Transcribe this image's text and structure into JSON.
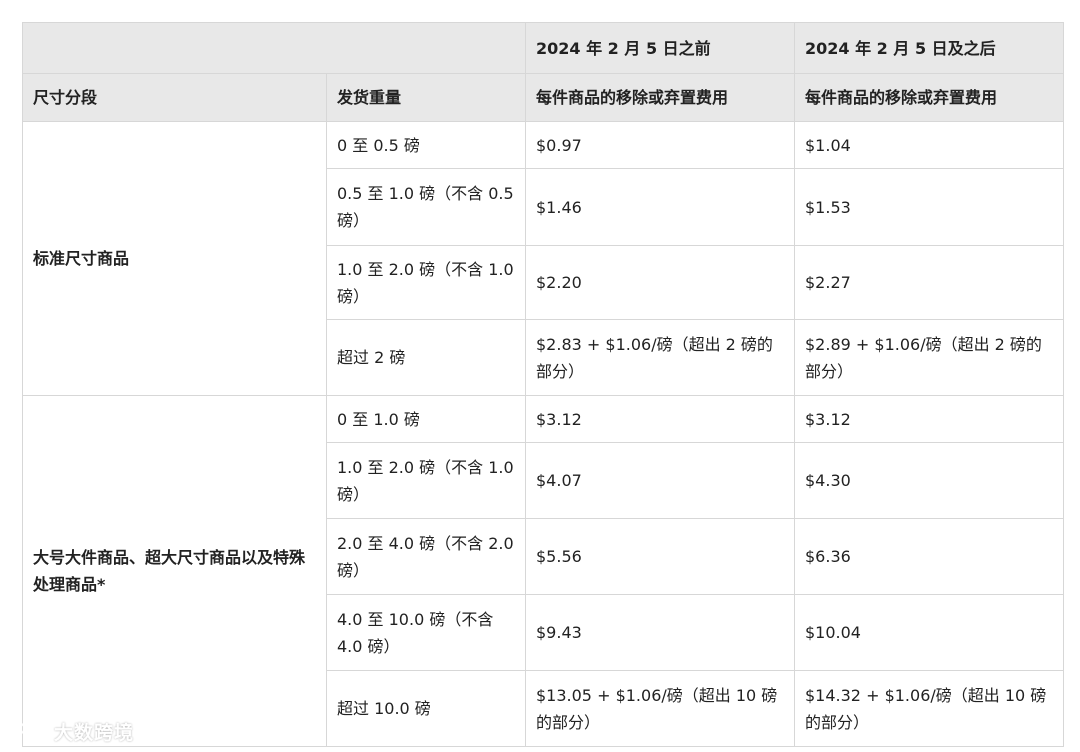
{
  "table": {
    "header_top": {
      "col3": "2024 年 2 月 5 日之前",
      "col4": "2024 年 2 月 5 日及之后"
    },
    "header_sub": {
      "col1": "尺寸分段",
      "col2": "发货重量",
      "col3": "每件商品的移除或弃置费用",
      "col4": "每件商品的移除或弃置费用"
    },
    "groups": [
      {
        "segment": "标准尺寸商品",
        "rows": [
          {
            "weight": "0 至 0.5 磅",
            "before": "$0.97",
            "after": "$1.04"
          },
          {
            "weight": "0.5 至 1.0 磅（不含 0.5 磅）",
            "before": "$1.46",
            "after": "$1.53"
          },
          {
            "weight": "1.0 至 2.0 磅（不含 1.0 磅）",
            "before": "$2.20",
            "after": "$2.27"
          },
          {
            "weight": "超过 2 磅",
            "before": "$2.83 + $1.06/磅（超出 2 磅的部分）",
            "after": "$2.89 + $1.06/磅（超出 2 磅的部分）"
          }
        ]
      },
      {
        "segment": "大号大件商品、超大尺寸商品以及特殊处理商品*",
        "rows": [
          {
            "weight": "0 至 1.0 磅",
            "before": "$3.12",
            "after": "$3.12"
          },
          {
            "weight": "1.0 至 2.0 磅（不含 1.0 磅）",
            "before": "$4.07",
            "after": "$4.30"
          },
          {
            "weight": "2.0 至 4.0 磅（不含 2.0 磅）",
            "before": "$5.56",
            "after": "$6.36"
          },
          {
            "weight": "4.0 至 10.0 磅（不含 4.0 磅）",
            "before": "$9.43",
            "after": "$10.04"
          },
          {
            "weight": "超过 10.0 磅",
            "before": "$13.05 + $1.06/磅（超出 10 磅的部分）",
            "after": "$14.32 + $1.06/磅（超出 10 磅的部分）"
          }
        ]
      }
    ]
  },
  "watermark": {
    "text": "大数跨境",
    "icon": "watermark-logo-icon"
  }
}
